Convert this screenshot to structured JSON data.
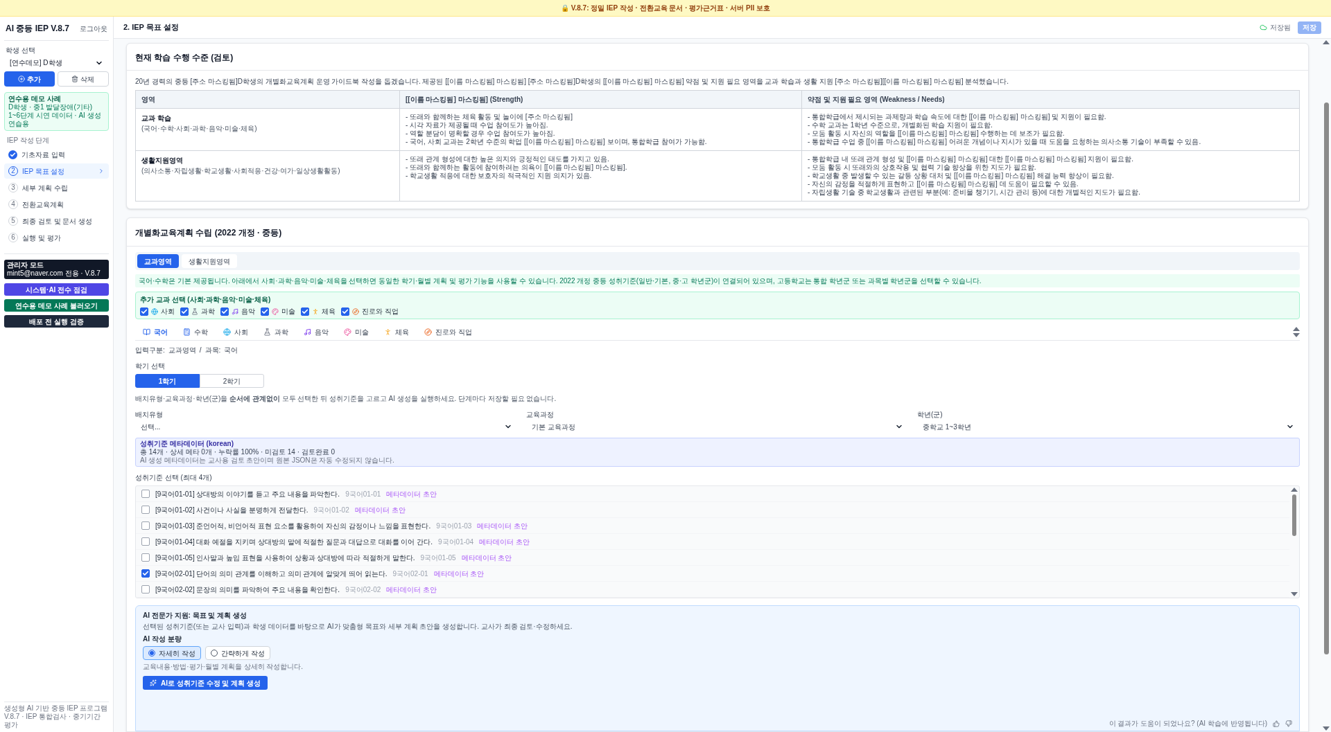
{
  "banner": "🔒 V.8.7: 정밀 IEP 작성 · 전환교육 문서 · 평가근거표 · 서버 PII 보호",
  "sidebar": {
    "app_title": "AI 중등 IEP V.8.7",
    "logout": "로그아웃",
    "student_label": "학생 선택",
    "student_value": "[연수데모] D학생",
    "add_button": "추가",
    "delete_button": "삭제",
    "demo_notice": {
      "title": "연수용 데모 사례",
      "lines": [
        "D학생 · 중1 발달장애(기타)",
        "1~6단계 시연 데이터 · AI 생성 연습용"
      ]
    },
    "steps_label": "IEP 작성 단계",
    "steps": [
      {
        "label": "기초자료 입력",
        "done": true,
        "selected": false
      },
      {
        "number": "2",
        "label": "IEP 목표 설정",
        "done": false,
        "selected": true
      },
      {
        "number": "3",
        "label": "세부 계획 수립",
        "done": false,
        "selected": false
      },
      {
        "number": "4",
        "label": "전환교육계획",
        "done": false,
        "selected": false
      },
      {
        "number": "5",
        "label": "최종 검토 및 문서 생성",
        "done": false,
        "selected": false
      },
      {
        "number": "6",
        "label": "실행 및 평가",
        "done": false,
        "selected": false
      }
    ],
    "admin": {
      "title": "관리자 모드",
      "subtitle": "mint5@naver.com 전용 · V.8.7"
    },
    "action_buttons": [
      {
        "label": "시스템·AI 전수 점검",
        "color": "#4f46e5"
      },
      {
        "label": "연수용 데모 사례 불러오기",
        "color": "#047857"
      },
      {
        "label": "배포 전 실행 검증",
        "color": "#1e293b"
      }
    ],
    "footer": [
      "생성형 AI 기반 중등 IEP 프로그램",
      "V.8.7 · IEP 통합검사 · 중기기간 평가"
    ]
  },
  "header": {
    "title": "2. IEP 목표 설정",
    "saved_status": "저장됨",
    "save_button": "저장"
  },
  "review": {
    "title": "현재 학습 수행 수준 (검토)",
    "intro": "20년 경력의 중등 [주소 마스킹됨]D학생의 개별화교육계획 운영 가이드북 작성을 돕겠습니다. 제공된 [[이름 마스킹됨] 마스킹됨] [주소 마스킹됨]D학생의 [[이름 마스킹됨] 마스킹됨] 약점 및 지원 필요 영역을 교과 학습과 생활 지원 [주소 마스킹됨][[이름 마스킹됨] 마스킹됨] 분석했습니다.",
    "columns": [
      "영역",
      "[[이름 마스킹됨] 마스킹됨] (Strength)",
      "약점 및 지원 필요 영역 (Weakness / Needs)"
    ],
    "rows": [
      {
        "area": "교과 학습",
        "area_sub": "(국어·수학·사회·과학·음악·미술·체육)",
        "strengths": [
          "- 또래와 함께하는 체육 활동 및 놀이에 [주소 마스킹됨]",
          "- 시각 자료가 제공될 때 수업 참여도가 높아짐.",
          "- 역할 분담이 명확할 경우 수업 참여도가 높아짐.",
          "- 국어, 사회 교과는 2학년 수준의 학업 [[이름 마스킹됨] 마스킹됨] 보이며, 통합학급 참여가 가능함."
        ],
        "needs": [
          "- 통합학급에서 제시되는 과제량과 학습 속도에 대한 [[이름 마스킹됨] 마스킹됨] 및 지원이 필요함.",
          "- 수학 교과는 1학년 수준으로, 개별화된 학습 지원이 필요함.",
          "- 모둠 활동 시 자신의 역할을 [[이름 마스킹됨] 마스킹됨] 수행하는 데 보조가 필요함.",
          "- 통합학급 수업 중 [[이름 마스킹됨] 마스킹됨] 어려운 개념이나 지시가 있을 때 도움을 요청하는 의사소통 기술이 부족할 수 있음."
        ]
      },
      {
        "area": "생활지원영역",
        "area_sub": "(의사소통·자립생활·학교생활·사회적응·건강·여가·일상생활활동)",
        "strengths": [
          "- 또래 관계 형성에 대한 높은 의지와 긍정적인 태도를 가지고 있음.",
          "- 또래와 함께하는 활동에 참여하려는 의욕이 [[이름 마스킹됨] 마스킹됨].",
          "- 학교생활 적응에 대한 보호자의 적극적인 지원 의지가 있음."
        ],
        "needs": [
          "- 통합학급 내 또래 관계 형성 및 [[이름 마스킹됨] 마스킹됨] 대한 [[이름 마스킹됨] 마스킹됨] 지원이 필요함.",
          "- 모둠 활동 시 또래와의 상호작용 및 협력 기술 향상을 위한 지도가 필요함.",
          "- 학교생활 중 발생할 수 있는 갈등 상황 대처 및 [[이름 마스킹됨] 마스킹됨] 해결 능력 향상이 필요함.",
          "- 자신의 감정을 적절하게 표현하고 [[이름 마스킹됨] 마스킹됨] 데 도움이 필요할 수 있음.",
          "- 자립생활 기술 중 학교생활과 관련된 부분(예: 준비물 챙기기, 시간 관리 등)에 대한 개별적인 지도가 필요함."
        ]
      }
    ]
  },
  "plan": {
    "title": "개별화교육계획 수립 (2022 개정 · 중등)",
    "tabs": [
      {
        "label": "교과영역",
        "selected": true
      },
      {
        "label": "생활지원영역",
        "selected": false
      }
    ],
    "notice": "국어·수학은 기본 제공됩니다. 아래에서 사회·과학·음악·미술·체육을 선택하면 동일한 학기·월별 계획 및 평가 기능을 사용할 수 있습니다. 2022 개정 중등 성취기준(일반·기본, 중·고 학년군)이 연결되어 있으며, 고등학교는 통합 학년군 또는 과목별 학년군을 선택할 수 있습니다.",
    "extra_subjects": {
      "title": "추가 교과 선택 (사회·과학·음악·미술·체육)",
      "items": [
        {
          "label": "사회",
          "checked": true
        },
        {
          "label": "과학",
          "checked": true
        },
        {
          "label": "음악",
          "checked": true
        },
        {
          "label": "미술",
          "checked": true
        },
        {
          "label": "체육",
          "checked": true
        },
        {
          "label": "진로와 직업",
          "checked": true
        }
      ]
    },
    "subject_tabs": [
      {
        "label": "국어",
        "selected": true
      },
      {
        "label": "수학",
        "selected": false
      },
      {
        "label": "사회",
        "selected": false
      },
      {
        "label": "과학",
        "selected": false
      },
      {
        "label": "음악",
        "selected": false
      },
      {
        "label": "미술",
        "selected": false
      },
      {
        "label": "체육",
        "selected": false
      },
      {
        "label": "진로와 직업",
        "selected": false
      }
    ],
    "breadcrumb": [
      "입력구분:",
      "교과영역",
      "/",
      "과목:",
      "국어"
    ],
    "semester": {
      "label": "학기 선택",
      "options": [
        {
          "label": "1학기",
          "selected": true
        },
        {
          "label": "2학기",
          "selected": false
        }
      ]
    },
    "hint": "배치유형·교육과정·학년(군)을 **순서에 관계없이** 모두 선택한 뒤 성취기준을 고르고 AI 생성을 실행하세요. 단계마다 저장할 필요 없습니다.",
    "selects": [
      {
        "label": "배치유형",
        "value": "선택..."
      },
      {
        "label": "교육과정",
        "value": "기본 교육과정"
      },
      {
        "label": "학년(군)",
        "value": "중학교 1~3학년"
      }
    ],
    "metadata": {
      "title": "성취기준 메타데이터 (korean)",
      "line": "총 14개 · 상세 메타 0개 · 누락률 100% · 미검토 14 · 검토완료 0",
      "note": "AI 생성 메타데이터는 교사용 검토 초안이며 원본 JSON은 자동 수정되지 않습니다."
    },
    "standards": {
      "label": "성취기준 선택 (최대 4개)",
      "items": [
        {
          "text": "[9국어01-01] 상대방의 이야기를 듣고 주요 내용을 파악한다.",
          "code": "9국어01-01",
          "tag": "메타데이터 초안",
          "checked": false
        },
        {
          "text": "[9국어01-02] 사건이나 사실을 분명하게 전달한다.",
          "code": "9국어01-02",
          "tag": "메타데이터 초안",
          "checked": false
        },
        {
          "text": "[9국어01-03] 준언어적, 비언어적 표현 요소를 활용하여 자신의 감정이나 느낌을 표현한다.",
          "code": "9국어01-03",
          "tag": "메타데이터 초안",
          "checked": false
        },
        {
          "text": "[9국어01-04] 대화 예절을 지키며 상대방의 말에 적절한 질문과 대답으로 대화를 이어 간다.",
          "code": "9국어01-04",
          "tag": "메타데이터 초안",
          "checked": false
        },
        {
          "text": "[9국어01-05] 인사말과 높임 표현을 사용하여 상황과 상대방에 따라 적절하게 말한다.",
          "code": "9국어01-05",
          "tag": "메타데이터 초안",
          "checked": false
        },
        {
          "text": "[9국어02-01] 단어의 의미 관계를 이해하고 의미 관계에 알맞게 띄어 읽는다.",
          "code": "9국어02-01",
          "tag": "메타데이터 초안",
          "checked": true
        },
        {
          "text": "[9국어02-02] 문장의 의미를 파악하여 주요 내용을 확인한다.",
          "code": "9국어02-02",
          "tag": "메타데이터 초안",
          "checked": false
        }
      ]
    },
    "ai": {
      "title": "AI 전문가 지원: 목표 및 계획 생성",
      "description": "선택된 성취기준(또는 교사 입력)과 학생 데이터를 바탕으로 AI가 맞춤형 목표와 세부 계획 초안을 생성합니다. 교사가 최종 검토·수정하세요.",
      "mode_label": "AI 작성 분량",
      "modes": [
        {
          "label": "자세히 작성",
          "selected": true
        },
        {
          "label": "간략하게 작성",
          "selected": false
        }
      ],
      "mode_note": "교육내용·방법·평가·월별 계획을 상세히 작성합니다.",
      "generate_button": "AI로 성취기준 수정 및 계획 생성",
      "feedback": "이 결과가 도움이 되었나요? (AI 학습에 반영됩니다)"
    }
  }
}
